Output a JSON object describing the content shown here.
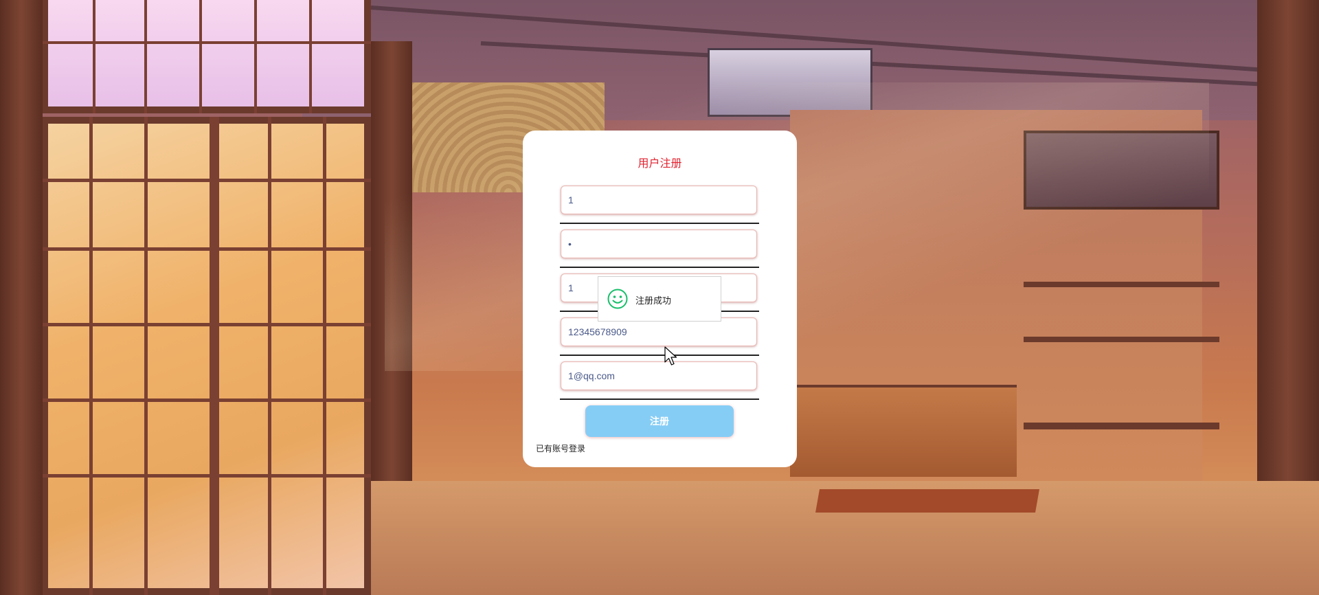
{
  "page": {
    "background": "anime-style sunlit japanese room"
  },
  "register_card": {
    "title": "用户注册",
    "fields": [
      {
        "name": "username",
        "value": "1"
      },
      {
        "name": "password",
        "value": "•"
      },
      {
        "name": "confirm",
        "value": "1"
      },
      {
        "name": "phone",
        "value": "12345678909"
      },
      {
        "name": "email",
        "value": "1@qq.com"
      }
    ],
    "submit_label": "注册",
    "login_link": "已有账号登录"
  },
  "toast": {
    "icon": "smile-icon",
    "message": "注册成功"
  },
  "colors": {
    "title": "#e0222f",
    "button": "#86cdf6",
    "toast_icon": "#19be6b"
  }
}
